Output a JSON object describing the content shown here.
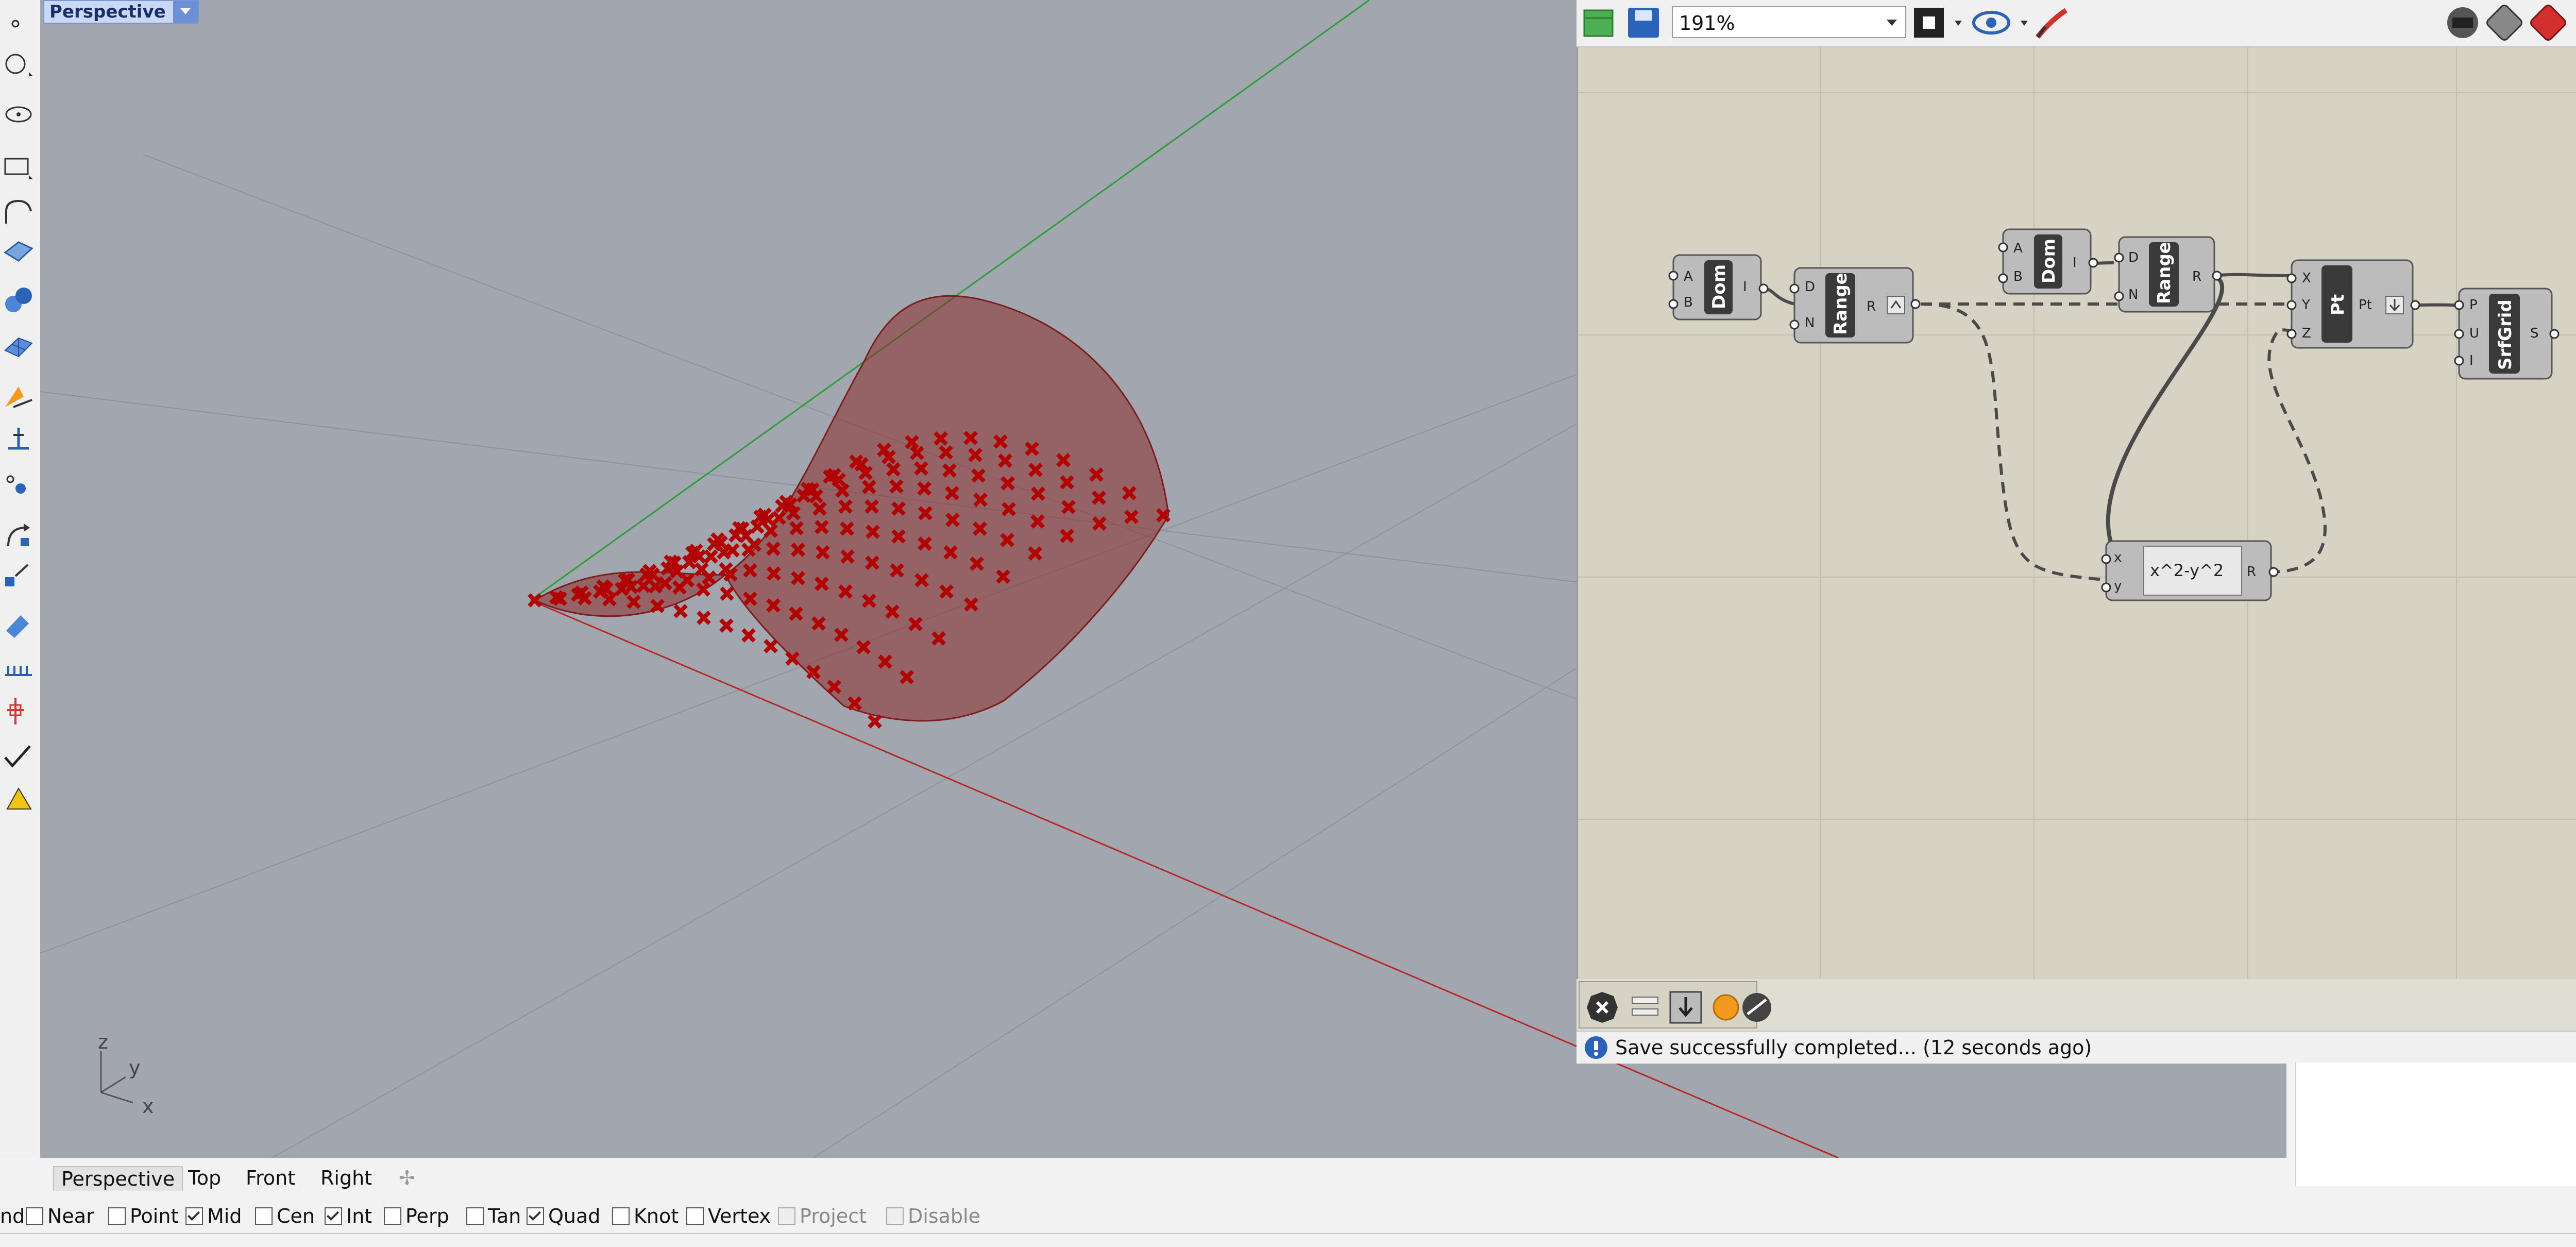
{
  "rhino": {
    "viewport_title": "Perspective",
    "view_tabs": [
      "Perspective",
      "Top",
      "Front",
      "Right"
    ],
    "axis_labels": {
      "x": "x",
      "y": "y",
      "z": "z"
    },
    "osnaps": [
      {
        "label": "nd",
        "checked": null
      },
      {
        "label": "Near",
        "checked": false
      },
      {
        "label": "Point",
        "checked": false
      },
      {
        "label": "Mid",
        "checked": true
      },
      {
        "label": "Cen",
        "checked": false
      },
      {
        "label": "Int",
        "checked": true
      },
      {
        "label": "Perp",
        "checked": false
      },
      {
        "label": "Tan",
        "checked": false
      },
      {
        "label": "Quad",
        "checked": true
      },
      {
        "label": "Knot",
        "checked": false
      },
      {
        "label": "Vertex",
        "checked": false
      },
      {
        "label": "Project",
        "checked": false
      },
      {
        "label": "Disable",
        "checked": false
      }
    ],
    "colors": {
      "surface": "#8b2a2a",
      "points": "#b30000",
      "x_axis": "#b52a2a",
      "y_axis": "#2e9e3a"
    }
  },
  "grasshopper": {
    "zoom": "191%",
    "status": "Save successfully completed... (12 seconds ago)",
    "components": {
      "dom1": {
        "label": "Dom",
        "inputs": [
          "A",
          "B"
        ],
        "output": "I"
      },
      "range1": {
        "label": "Range",
        "inputs": [
          "D",
          "N"
        ],
        "output": "R"
      },
      "dom2": {
        "label": "Dom",
        "inputs": [
          "A",
          "B"
        ],
        "output": "I"
      },
      "range2": {
        "label": "Range",
        "inputs": [
          "D",
          "N"
        ],
        "output": "R"
      },
      "pt": {
        "label": "Pt",
        "inputs": [
          "X",
          "Y",
          "Z"
        ],
        "output": "Pt"
      },
      "srfgrid": {
        "label": "SrfGrid",
        "inputs": [
          "P",
          "U",
          "I"
        ],
        "output": "S"
      },
      "expr": {
        "expression": "x^2-y^2",
        "inputs": [
          "x",
          "y"
        ],
        "output": "R"
      }
    }
  }
}
